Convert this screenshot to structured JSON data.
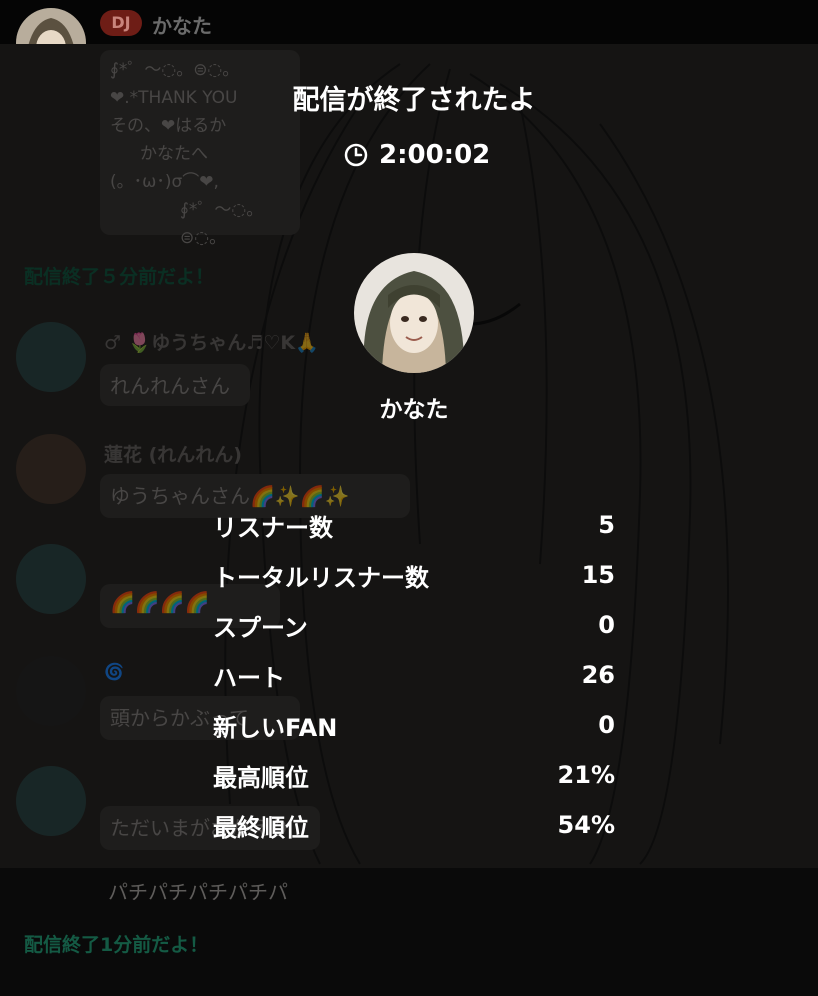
{
  "header": {
    "dj_badge": "DJ",
    "name": "かなた"
  },
  "chat": {
    "message1_lines": [
      "∮*゜〜◌。⊜◌。",
      "❤︎.*THANK YOU",
      "その、❤︎はるか",
      "かなたへ",
      "(。･ω･)σ⌒❤︎,",
      "∮*゜〜◌。⊜◌。"
    ],
    "sys1": "配信終了５分前だよ！",
    "user_yuu": "♂ 🌷ゆうちゃん♬♡K🙏",
    "msg_yuu1": "れんれんさん",
    "user_renka": "蓮花 (れんれん)",
    "msg_renka": "ゆうちゃんさん🌈✨🌈✨",
    "msg_yuu2": "🌈🌈🌈🌈",
    "user_blue": "🌀",
    "msg_blue": "頭からかぶって",
    "msg_yuu3": "ただいまがおかえり",
    "plain1": "パチパチパチパチパ",
    "sys2": "配信終了1分前だよ！"
  },
  "modal": {
    "title": "配信が終了されたよ",
    "duration": "2:00:02",
    "dj_name": "かなた",
    "stats": [
      {
        "label": "リスナー数",
        "value": "5"
      },
      {
        "label": "トータルリスナー数",
        "value": "15"
      },
      {
        "label": "スプーン",
        "value": "0"
      },
      {
        "label": "ハート",
        "value": "26"
      },
      {
        "label": "新しいFAN",
        "value": "0"
      },
      {
        "label": "最高順位",
        "value": "21%"
      },
      {
        "label": "最終順位",
        "value": "54%"
      }
    ]
  }
}
